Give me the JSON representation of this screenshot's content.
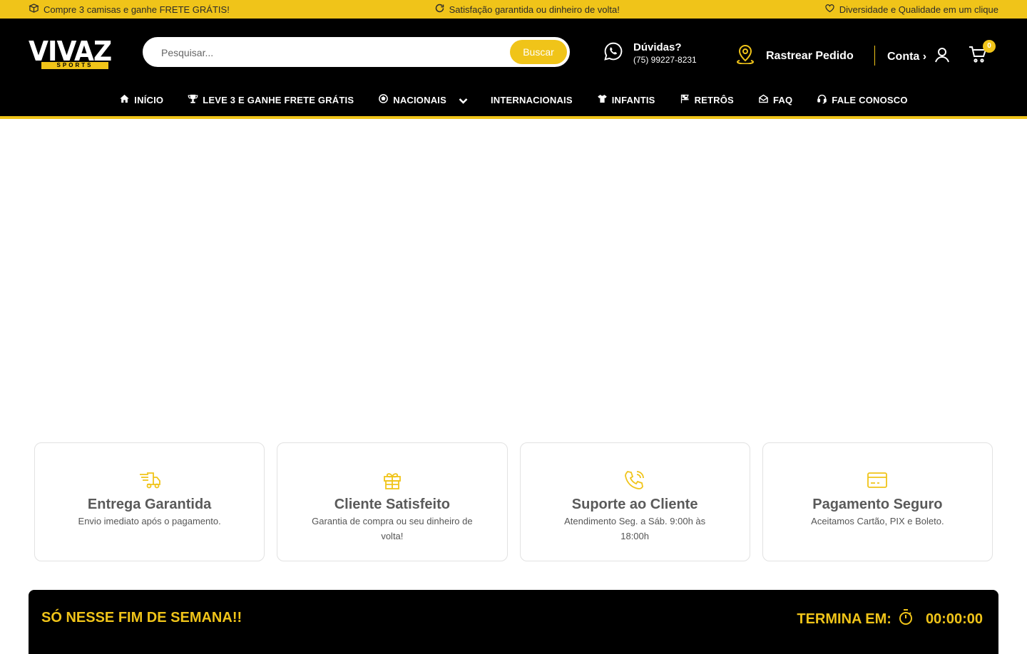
{
  "announcements": [
    {
      "icon": "box-icon",
      "text": "Compre 3 camisas e ganhe FRETE GRÁTIS!"
    },
    {
      "icon": "refresh-icon",
      "text": "Satisfação garantida ou dinheiro de volta!"
    },
    {
      "icon": "heart-icon",
      "text": "Diversidade e Qualidade em um clique"
    }
  ],
  "logo": {
    "word": "VIVAZ",
    "sub": "SPORTS"
  },
  "search": {
    "placeholder": "Pesquisar...",
    "button": "Buscar"
  },
  "help": {
    "title": "Dúvidas?",
    "phone": "(75) 99227-8231"
  },
  "track": {
    "label": "Rastrear Pedido"
  },
  "account": {
    "label": "Conta ›"
  },
  "cart": {
    "count": "0"
  },
  "nav": [
    {
      "label": "INÍCIO",
      "icon": "home-icon"
    },
    {
      "label": "LEVE 3 E GANHE FRETE GRÁTIS",
      "icon": "trophy-icon"
    },
    {
      "label": "NACIONAIS",
      "icon": "soccer-ball-icon"
    },
    {
      "label": "INTERNACIONAIS",
      "icon": ""
    },
    {
      "label": "INFANTIS",
      "icon": "shirt-icon"
    },
    {
      "label": "RETRÔS",
      "icon": "checkered-flag-icon"
    },
    {
      "label": "FAQ",
      "icon": "envelope-open-icon"
    },
    {
      "label": "FALE CONOSCO",
      "icon": "headset-icon"
    }
  ],
  "features": [
    {
      "icon": "delivery-truck-icon",
      "title": "Entrega Garantida",
      "desc": "Envio imediato após o pagamento."
    },
    {
      "icon": "gift-icon",
      "title": "Cliente Satisfeito",
      "desc": "Garantia de compra ou seu dinheiro de volta!"
    },
    {
      "icon": "phone-call-icon",
      "title": "Suporte ao Cliente",
      "desc": "Atendimento Seg. a Sáb. 9:00h às 18:00h"
    },
    {
      "icon": "credit-card-icon",
      "title": "Pagamento Seguro",
      "desc": "Aceitamos Cartão, PIX e Boleto."
    }
  ],
  "banner": {
    "left": "SÓ NESSE FIM DE SEMANA!!",
    "ends_label": "TERMINA EM:",
    "timer": "00:00:00"
  },
  "colors": {
    "accent": "#f0c419",
    "header": "#000000"
  }
}
